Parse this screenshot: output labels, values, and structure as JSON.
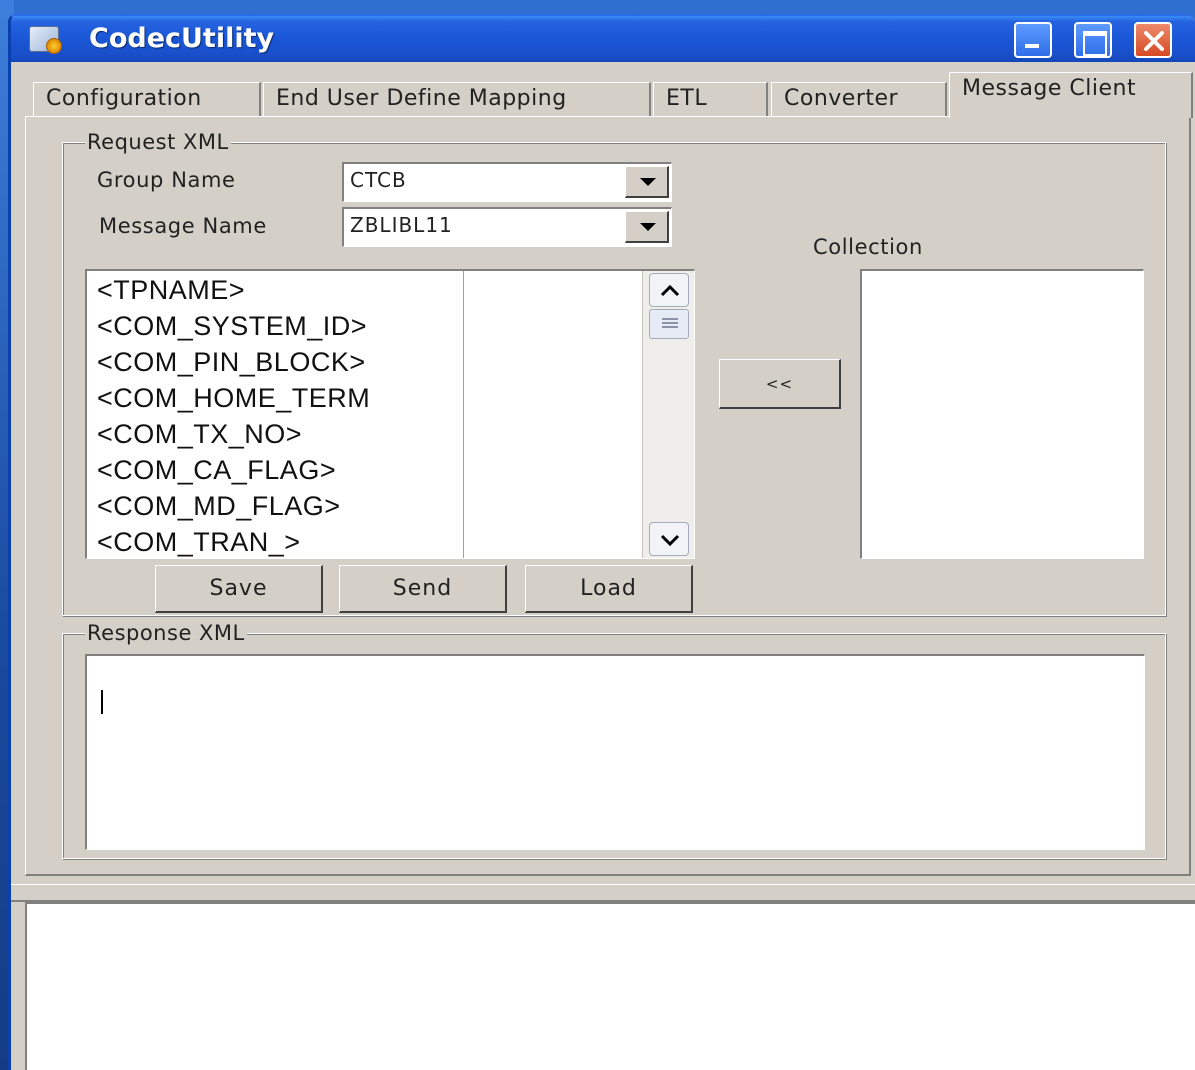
{
  "window": {
    "title": "CodecUtility"
  },
  "tabs": [
    {
      "label": "Configuration"
    },
    {
      "label": "End User Define Mapping"
    },
    {
      "label": "ETL"
    },
    {
      "label": "Converter"
    },
    {
      "label": "Message Client"
    }
  ],
  "active_tab": "Message Client",
  "request": {
    "legend": "Request XML",
    "group_name_label": "Group Name",
    "group_name_value": "CTCB",
    "message_name_label": "Message Name",
    "message_name_value": "ZBLIBL11",
    "fields": [
      "<TPNAME>",
      "<COM_SYSTEM_ID>",
      "<COM_PIN_BLOCK>",
      "<COM_HOME_TERM",
      "<COM_TX_NO>",
      "<COM_CA_FLAG>",
      "<COM_MD_FLAG>",
      "<COM_TRAN_>"
    ],
    "move_button_label": "<<",
    "collection_label": "Collection",
    "save_label": "Save",
    "send_label": "Send",
    "load_label": "Load"
  },
  "response": {
    "legend": "Response XML",
    "value": ""
  },
  "log": {
    "value": ""
  },
  "icons": {
    "app": "app-icon",
    "minimize": "minimize-icon",
    "maximize": "maximize-icon",
    "close": "close-icon",
    "scroll_up": "chevron-up-icon",
    "scroll_down": "chevron-down-icon",
    "dropdown": "dropdown-arrow-icon"
  },
  "colors": {
    "titlebar": "#1a56d6",
    "window_face": "#d4d0c8",
    "close_button": "#d64a23"
  }
}
